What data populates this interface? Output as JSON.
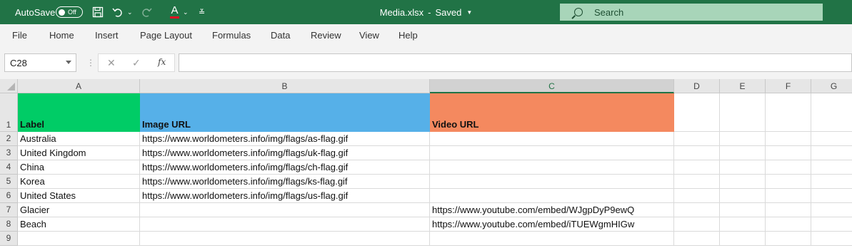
{
  "titlebar": {
    "autosave_label": "AutoSave",
    "autosave_state": "Off",
    "title": "Media.xlsx",
    "saved_status": "Saved",
    "search_placeholder": "Search",
    "bg_color": "#217346"
  },
  "menu": [
    "File",
    "Home",
    "Insert",
    "Page Layout",
    "Formulas",
    "Data",
    "Review",
    "View",
    "Help"
  ],
  "formula_bar": {
    "name_box": "C28",
    "fx_label": "fx",
    "formula": ""
  },
  "columns": [
    "A",
    "B",
    "C",
    "D",
    "E",
    "F",
    "G"
  ],
  "active_column": "C",
  "rows": [
    "1",
    "2",
    "3",
    "4",
    "5",
    "6",
    "7",
    "8",
    "9"
  ],
  "header_row": {
    "label": "Label",
    "image_url": "Image URL",
    "video_url": "Video URL"
  },
  "header_colors": {
    "label": "#00cc66",
    "image_url": "#56b0e8",
    "video_url": "#f4895f"
  },
  "data_rows": [
    {
      "label": "Australia",
      "image_url": "https://www.worldometers.info/img/flags/as-flag.gif",
      "video_url": ""
    },
    {
      "label": "United Kingdom",
      "image_url": "https://www.worldometers.info/img/flags/uk-flag.gif",
      "video_url": ""
    },
    {
      "label": "China",
      "image_url": "https://www.worldometers.info/img/flags/ch-flag.gif",
      "video_url": ""
    },
    {
      "label": "Korea",
      "image_url": "https://www.worldometers.info/img/flags/ks-flag.gif",
      "video_url": ""
    },
    {
      "label": "United States",
      "image_url": "https://www.worldometers.info/img/flags/us-flag.gif",
      "video_url": ""
    },
    {
      "label": "Glacier",
      "image_url": "",
      "video_url": "https://www.youtube.com/embed/WJgpDyP9ewQ"
    },
    {
      "label": "Beach",
      "image_url": "",
      "video_url": "https://www.youtube.com/embed/iTUEWgmHIGw"
    },
    {
      "label": "",
      "image_url": "",
      "video_url": ""
    }
  ]
}
